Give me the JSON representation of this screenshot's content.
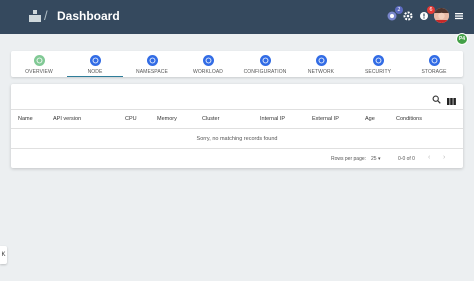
{
  "app": {
    "title": "Dashboard",
    "separator": "/"
  },
  "header_icons": {
    "logo": "cluster-logo-icon",
    "notifications_badge": "2",
    "settings": "gear-icon",
    "alerts_badge": "6",
    "menu": "hamburger-menu-icon",
    "colors": {
      "bar": "#35495e",
      "notifications_badge": "#5c6bc0",
      "alerts_badge": "#e53935"
    }
  },
  "floating_badge": "P4",
  "tabs": [
    {
      "label": "OVERVIEW",
      "icon": "overview-icon",
      "active": false
    },
    {
      "label": "NODE",
      "icon": "node-icon",
      "active": true
    },
    {
      "label": "NAMESPACE",
      "icon": "namespace-icon",
      "active": false
    },
    {
      "label": "WORKLOAD",
      "icon": "workload-icon",
      "active": false
    },
    {
      "label": "CONFIGURATION",
      "icon": "configuration-icon",
      "active": false
    },
    {
      "label": "NETWORK",
      "icon": "network-icon",
      "active": false
    },
    {
      "label": "SECURITY",
      "icon": "security-icon",
      "active": false
    },
    {
      "label": "STORAGE",
      "icon": "storage-icon",
      "active": false
    }
  ],
  "table": {
    "columns": [
      "Name",
      "API version",
      "CPU",
      "Memory",
      "Cluster",
      "Internal IP",
      "External IP",
      "Age",
      "Conditions"
    ],
    "empty_message": "Sorry, no matching records found"
  },
  "pagination": {
    "rows_per_page_label": "Rows per page:",
    "rows_per_page": "25",
    "range": "0-0 of 0"
  },
  "side_handle": "K"
}
